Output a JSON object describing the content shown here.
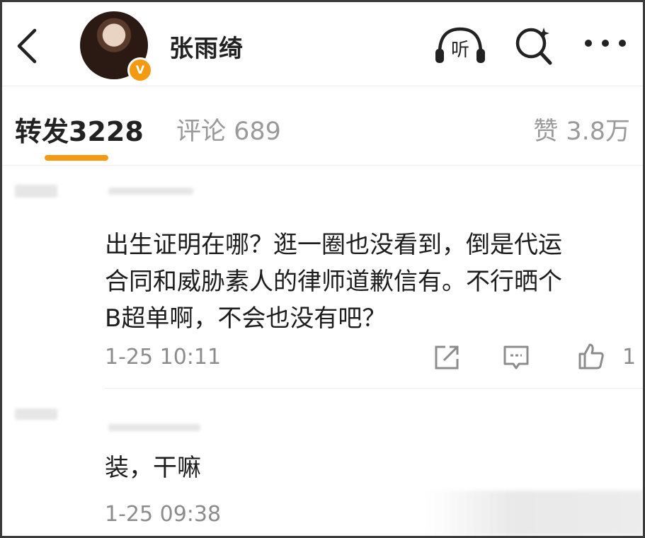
{
  "header": {
    "username": "张雨绮",
    "verified_badge": "V",
    "icons": [
      "back-icon",
      "listen-icon",
      "search-icon",
      "more-icon"
    ],
    "listen_label": "听"
  },
  "tabs": {
    "repost": "转发3228",
    "comments": "评论 689",
    "likes": "赞 3.8万"
  },
  "comments": [
    {
      "text": "出生证明在哪？逛一圈也没看到，倒是代运\n合同和威胁素人的律师道歉信有。不行晒个\nB超单啊，不会也没有吧？",
      "time": "1-25 10:11",
      "likes": "1"
    },
    {
      "text": "装，干嘛",
      "time": "1-25 09:38"
    }
  ],
  "colors": {
    "accent": "#f39a12",
    "muted": "#8c8c8c"
  }
}
